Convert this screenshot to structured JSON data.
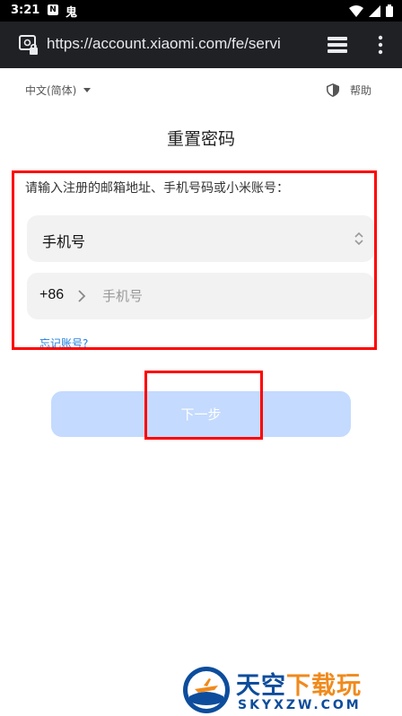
{
  "status_bar": {
    "time": "3:21",
    "notification_badge": "N",
    "app_glyph": "鬼"
  },
  "browser": {
    "url": "https://account.xiaomi.com/fe/servi",
    "icons": {
      "site": "site-info-lock-icon",
      "tabs": "tab-switcher-icon",
      "menu": "overflow-menu-icon"
    }
  },
  "header": {
    "language": "中文(简体)",
    "help": "帮助"
  },
  "page": {
    "title": "重置密码",
    "prompt": "请输入注册的邮箱地址、手机号码或小米账号：",
    "account_type": {
      "selected": "手机号"
    },
    "phone": {
      "country_code": "+86",
      "placeholder": "手机号",
      "value": ""
    },
    "forgot_account": "忘记账号?",
    "next_button": "下一步"
  },
  "watermark": {
    "title_part1": "天空",
    "title_part2": "下载玩",
    "subtitle": "SKYXZW.COM"
  },
  "colors": {
    "accent_link": "#1f7fe0",
    "next_button_disabled": "#c4dafe",
    "annotation_red": "#ff0000",
    "field_background": "#f2f2f2",
    "url_bar": "#202124"
  }
}
